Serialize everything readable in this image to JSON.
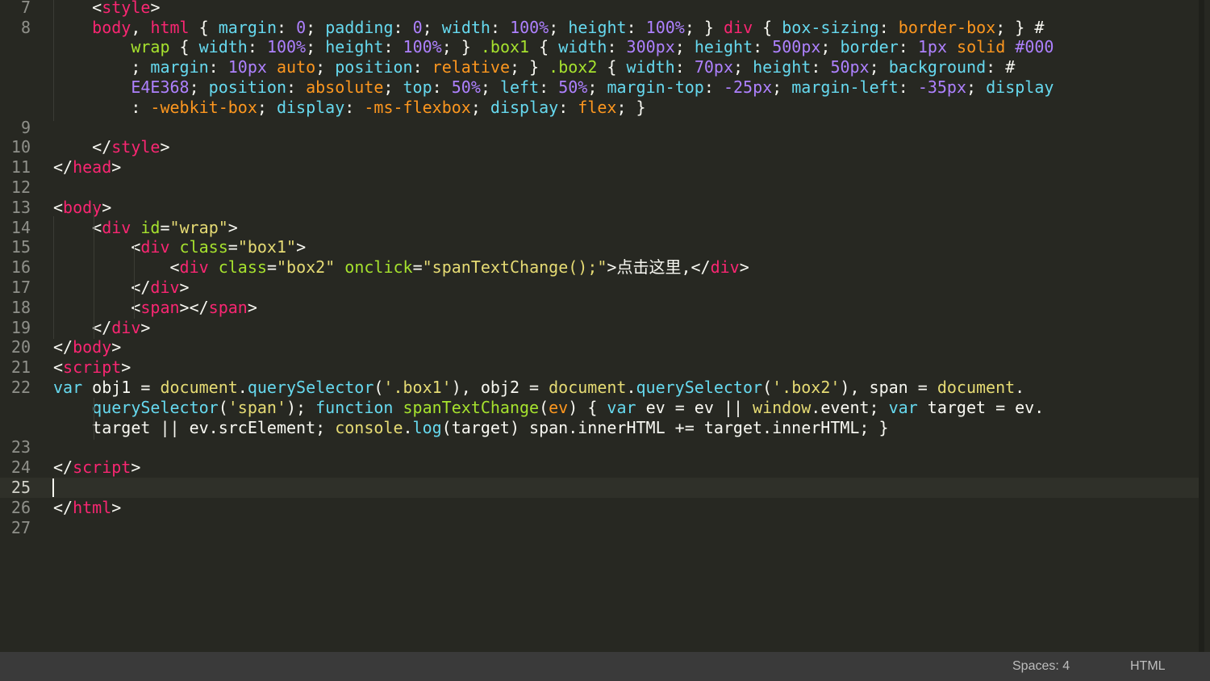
{
  "editor": {
    "line_numbers": [
      "7",
      "8",
      "",
      "",
      "",
      "",
      "9",
      "10",
      "11",
      "12",
      "13",
      "14",
      "15",
      "16",
      "17",
      "18",
      "19",
      "20",
      "21",
      "22",
      "",
      "",
      "23",
      "24",
      "25",
      "26",
      "27"
    ],
    "current_line": "25",
    "lines": [
      {
        "tokens": [
          [
            "w",
            "    "
          ],
          [
            "w",
            "<"
          ],
          [
            "t",
            "style"
          ],
          [
            "w",
            ">"
          ]
        ]
      },
      {
        "tokens": [
          [
            "w",
            "    "
          ],
          [
            "t",
            "body"
          ],
          [
            "w",
            ", "
          ],
          [
            "t",
            "html"
          ],
          [
            "w",
            " { "
          ],
          [
            "k",
            "margin"
          ],
          [
            "w",
            ": "
          ],
          [
            "n",
            "0"
          ],
          [
            "w",
            "; "
          ],
          [
            "k",
            "padding"
          ],
          [
            "w",
            ": "
          ],
          [
            "n",
            "0"
          ],
          [
            "w",
            "; "
          ],
          [
            "k",
            "width"
          ],
          [
            "w",
            ": "
          ],
          [
            "n",
            "100%"
          ],
          [
            "w",
            "; "
          ],
          [
            "k",
            "height"
          ],
          [
            "w",
            ": "
          ],
          [
            "n",
            "100%"
          ],
          [
            "w",
            "; } "
          ],
          [
            "t",
            "div"
          ],
          [
            "w",
            " { "
          ],
          [
            "k",
            "box-sizing"
          ],
          [
            "w",
            ": "
          ],
          [
            "v",
            "border-box"
          ],
          [
            "w",
            "; } #"
          ]
        ]
      },
      {
        "tokens": [
          [
            "w",
            "        "
          ],
          [
            "a",
            "wrap"
          ],
          [
            "w",
            " { "
          ],
          [
            "k",
            "width"
          ],
          [
            "w",
            ": "
          ],
          [
            "n",
            "100%"
          ],
          [
            "w",
            "; "
          ],
          [
            "k",
            "height"
          ],
          [
            "w",
            ": "
          ],
          [
            "n",
            "100%"
          ],
          [
            "w",
            "; } "
          ],
          [
            "a",
            ".box1"
          ],
          [
            "w",
            " { "
          ],
          [
            "k",
            "width"
          ],
          [
            "w",
            ": "
          ],
          [
            "n",
            "300px"
          ],
          [
            "w",
            "; "
          ],
          [
            "k",
            "height"
          ],
          [
            "w",
            ": "
          ],
          [
            "n",
            "500px"
          ],
          [
            "w",
            "; "
          ],
          [
            "k",
            "border"
          ],
          [
            "w",
            ": "
          ],
          [
            "n",
            "1px"
          ],
          [
            "w",
            " "
          ],
          [
            "v",
            "solid"
          ],
          [
            "w",
            " "
          ],
          [
            "n",
            "#000"
          ]
        ]
      },
      {
        "tokens": [
          [
            "w",
            "        ; "
          ],
          [
            "k",
            "margin"
          ],
          [
            "w",
            ": "
          ],
          [
            "n",
            "10px"
          ],
          [
            "w",
            " "
          ],
          [
            "v",
            "auto"
          ],
          [
            "w",
            "; "
          ],
          [
            "k",
            "position"
          ],
          [
            "w",
            ": "
          ],
          [
            "v",
            "relative"
          ],
          [
            "w",
            "; } "
          ],
          [
            "a",
            ".box2"
          ],
          [
            "w",
            " { "
          ],
          [
            "k",
            "width"
          ],
          [
            "w",
            ": "
          ],
          [
            "n",
            "70px"
          ],
          [
            "w",
            "; "
          ],
          [
            "k",
            "height"
          ],
          [
            "w",
            ": "
          ],
          [
            "n",
            "50px"
          ],
          [
            "w",
            "; "
          ],
          [
            "k",
            "background"
          ],
          [
            "w",
            ": #"
          ]
        ]
      },
      {
        "tokens": [
          [
            "w",
            "        "
          ],
          [
            "n",
            "E4E368"
          ],
          [
            "w",
            "; "
          ],
          [
            "k",
            "position"
          ],
          [
            "w",
            ": "
          ],
          [
            "v",
            "absolute"
          ],
          [
            "w",
            "; "
          ],
          [
            "k",
            "top"
          ],
          [
            "w",
            ": "
          ],
          [
            "n",
            "50%"
          ],
          [
            "w",
            "; "
          ],
          [
            "k",
            "left"
          ],
          [
            "w",
            ": "
          ],
          [
            "n",
            "50%"
          ],
          [
            "w",
            "; "
          ],
          [
            "k",
            "margin-top"
          ],
          [
            "w",
            ": "
          ],
          [
            "n",
            "-25px"
          ],
          [
            "w",
            "; "
          ],
          [
            "k",
            "margin-left"
          ],
          [
            "w",
            ": "
          ],
          [
            "n",
            "-35px"
          ],
          [
            "w",
            "; "
          ],
          [
            "k",
            "display"
          ]
        ]
      },
      {
        "tokens": [
          [
            "w",
            "        : "
          ],
          [
            "v",
            "-webkit-box"
          ],
          [
            "w",
            "; "
          ],
          [
            "k",
            "display"
          ],
          [
            "w",
            ": "
          ],
          [
            "v",
            "-ms-flexbox"
          ],
          [
            "w",
            "; "
          ],
          [
            "k",
            "display"
          ],
          [
            "w",
            ": "
          ],
          [
            "v",
            "flex"
          ],
          [
            "w",
            "; }"
          ]
        ]
      },
      {
        "tokens": []
      },
      {
        "tokens": [
          [
            "w",
            "    </"
          ],
          [
            "t",
            "style"
          ],
          [
            "w",
            ">"
          ]
        ]
      },
      {
        "tokens": [
          [
            "w",
            "</"
          ],
          [
            "t",
            "head"
          ],
          [
            "w",
            ">"
          ]
        ]
      },
      {
        "tokens": []
      },
      {
        "tokens": [
          [
            "w",
            "<"
          ],
          [
            "t",
            "body"
          ],
          [
            "w",
            ">"
          ]
        ]
      },
      {
        "tokens": [
          [
            "w",
            "    <"
          ],
          [
            "t",
            "div"
          ],
          [
            "w",
            " "
          ],
          [
            "a",
            "id"
          ],
          [
            "w",
            "="
          ],
          [
            "s",
            "\"wrap\""
          ],
          [
            "w",
            ">"
          ]
        ]
      },
      {
        "tokens": [
          [
            "w",
            "        <"
          ],
          [
            "t",
            "div"
          ],
          [
            "w",
            " "
          ],
          [
            "a",
            "class"
          ],
          [
            "w",
            "="
          ],
          [
            "s",
            "\"box1\""
          ],
          [
            "w",
            ">"
          ]
        ]
      },
      {
        "tokens": [
          [
            "w",
            "            <"
          ],
          [
            "t",
            "div"
          ],
          [
            "w",
            " "
          ],
          [
            "a",
            "class"
          ],
          [
            "w",
            "="
          ],
          [
            "s",
            "\"box2\""
          ],
          [
            "w",
            " "
          ],
          [
            "a",
            "onclick"
          ],
          [
            "w",
            "="
          ],
          [
            "s",
            "\"spanTextChange();\""
          ],
          [
            "w",
            ">点击这里,</"
          ],
          [
            "t",
            "div"
          ],
          [
            "w",
            ">"
          ]
        ]
      },
      {
        "tokens": [
          [
            "w",
            "        </"
          ],
          [
            "t",
            "div"
          ],
          [
            "w",
            ">"
          ]
        ]
      },
      {
        "tokens": [
          [
            "w",
            "        <"
          ],
          [
            "t",
            "span"
          ],
          [
            "w",
            "></"
          ],
          [
            "t",
            "span"
          ],
          [
            "w",
            ">"
          ]
        ]
      },
      {
        "tokens": [
          [
            "w",
            "    </"
          ],
          [
            "t",
            "div"
          ],
          [
            "w",
            ">"
          ]
        ]
      },
      {
        "tokens": [
          [
            "w",
            "</"
          ],
          [
            "t",
            "body"
          ],
          [
            "w",
            ">"
          ]
        ]
      },
      {
        "tokens": [
          [
            "w",
            "<"
          ],
          [
            "t",
            "script"
          ],
          [
            "w",
            ">"
          ]
        ]
      },
      {
        "tokens": [
          [
            "k",
            "var"
          ],
          [
            "w",
            " obj1 = "
          ],
          [
            "s",
            "document"
          ],
          [
            "w",
            "."
          ],
          [
            "k",
            "querySelector"
          ],
          [
            "w",
            "("
          ],
          [
            "s",
            "'.box1'"
          ],
          [
            "w",
            "), obj2 = "
          ],
          [
            "s",
            "document"
          ],
          [
            "w",
            "."
          ],
          [
            "k",
            "querySelector"
          ],
          [
            "w",
            "("
          ],
          [
            "s",
            "'.box2'"
          ],
          [
            "w",
            "), span = "
          ],
          [
            "s",
            "document"
          ],
          [
            "w",
            "."
          ]
        ]
      },
      {
        "tokens": [
          [
            "w",
            "    "
          ],
          [
            "k",
            "querySelector"
          ],
          [
            "w",
            "("
          ],
          [
            "s",
            "'span'"
          ],
          [
            "w",
            "); "
          ],
          [
            "k",
            "function"
          ],
          [
            "w",
            " "
          ],
          [
            "a",
            "spanTextChange"
          ],
          [
            "w",
            "("
          ],
          [
            "v",
            "ev"
          ],
          [
            "w",
            ") { "
          ],
          [
            "k",
            "var"
          ],
          [
            "w",
            " ev = ev || "
          ],
          [
            "s",
            "window"
          ],
          [
            "w",
            ".event; "
          ],
          [
            "k",
            "var"
          ],
          [
            "w",
            " target = ev."
          ]
        ]
      },
      {
        "tokens": [
          [
            "w",
            "    target || ev.srcElement; "
          ],
          [
            "s",
            "console"
          ],
          [
            "w",
            "."
          ],
          [
            "k",
            "log"
          ],
          [
            "w",
            "(target) span.innerHTML += target.innerHTML; }"
          ]
        ]
      },
      {
        "tokens": []
      },
      {
        "tokens": [
          [
            "w",
            "</"
          ],
          [
            "t",
            "script"
          ],
          [
            "w",
            ">"
          ]
        ]
      },
      {
        "tokens": []
      },
      {
        "tokens": [
          [
            "w",
            "</"
          ],
          [
            "t",
            "html"
          ],
          [
            "w",
            ">"
          ]
        ]
      },
      {
        "tokens": []
      }
    ]
  },
  "status_bar": {
    "indentation": "Spaces: 4",
    "syntax": "HTML"
  },
  "colors": {
    "background": "#272822",
    "tag": "#f92672",
    "attribute": "#a6e22e",
    "string": "#e6db74",
    "number": "#ae81ff",
    "keyword": "#66d9ef",
    "value": "#fd971f",
    "text": "#f8f8f2"
  }
}
